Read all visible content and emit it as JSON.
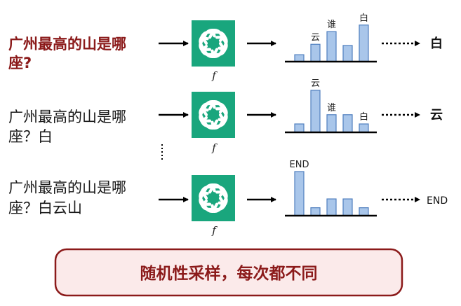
{
  "colors": {
    "accent": "#8b1a1a",
    "logo_bg": "#19a67d",
    "bar_fill": "#a9c6ea",
    "bar_stroke": "#4f7fbf",
    "banner_fill": "#fbeaea",
    "banner_stroke": "#8b1a1a"
  },
  "func_label": "f",
  "banner": {
    "text": "随机性采样，每次都不同"
  },
  "rows": [
    {
      "prompt_line1": "广州最高的山是哪",
      "prompt_line2": "座?",
      "highlight": true,
      "bars": [
        {
          "value": 0.18,
          "label": ""
        },
        {
          "value": 0.45,
          "label": "云"
        },
        {
          "value": 0.78,
          "label": "谁"
        },
        {
          "value": 0.42,
          "label": ""
        },
        {
          "value": 0.95,
          "label": "白"
        }
      ],
      "result": "白"
    },
    {
      "prompt_line1": "广州最高的山是哪",
      "prompt_line2": "座？白",
      "highlight": false,
      "bars": [
        {
          "value": 0.2,
          "label": ""
        },
        {
          "value": 1.0,
          "label": "云"
        },
        {
          "value": 0.42,
          "label": "谁"
        },
        {
          "value": 0.42,
          "label": ""
        },
        {
          "value": 0.2,
          "label": "白"
        }
      ],
      "result": "云"
    },
    {
      "prompt_line1": "广州最高的山是哪",
      "prompt_line2": "座？白云山",
      "highlight": false,
      "bars": [
        {
          "value": 1.0,
          "label": "END"
        },
        {
          "value": 0.18,
          "label": ""
        },
        {
          "value": 0.38,
          "label": ""
        },
        {
          "value": 0.38,
          "label": ""
        },
        {
          "value": 0.18,
          "label": ""
        }
      ],
      "result": "END"
    }
  ]
}
